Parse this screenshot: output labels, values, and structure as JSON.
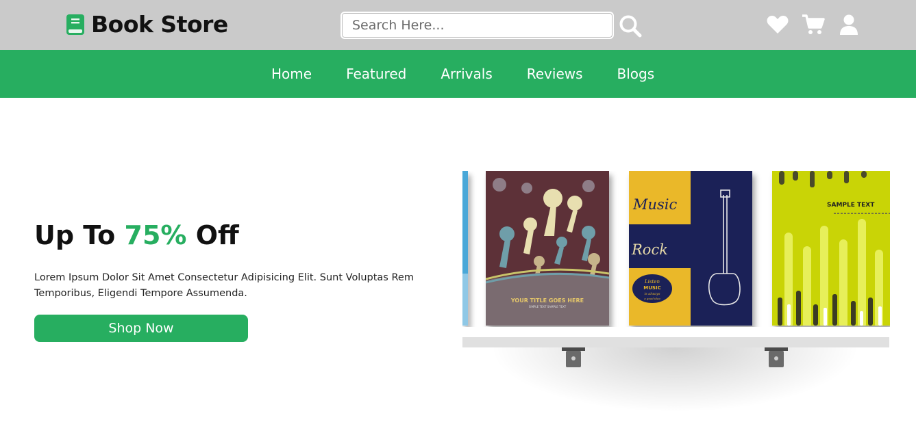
{
  "header": {
    "logo_text": "Book Store",
    "search_placeholder": "Search Here...",
    "icons": [
      "heart-icon",
      "cart-icon",
      "user-icon"
    ]
  },
  "nav": {
    "links": [
      "Home",
      "Featured",
      "Arrivals",
      "Reviews",
      "Blogs"
    ]
  },
  "hero": {
    "title_before": "Up To ",
    "title_accent": "75%",
    "title_after": " Off",
    "description": "Lorem Ipsum Dolor Sit Amet Consectetur Adipisicing Elit. Sunt Voluptas Rem Temporibus, Eligendi Tempore Assumenda.",
    "button_label": "Shop Now"
  },
  "books": {
    "book1_title": "YOUR TITLE GOES HERE",
    "book1_subtitle": "SIMPLE TEXT SAMPLE TEXT",
    "book2_word1": "Music",
    "book2_word2": "Rock",
    "book2_badge_l1": "Listen",
    "book2_badge_l2": "MUSIC",
    "book2_badge_l3": "is always",
    "book2_badge_l4": "a good idea",
    "book3_title": "SAMPLE TEXT"
  },
  "colors": {
    "brand_green": "#27ae60",
    "header_gray": "#cacaca"
  }
}
